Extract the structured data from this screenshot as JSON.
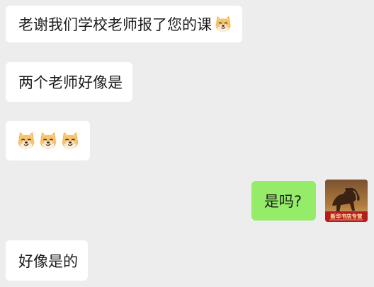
{
  "messages": [
    {
      "side": "left",
      "text": "老谢我们学校老师报了您的课",
      "emoji": "doge-emoji"
    },
    {
      "side": "left",
      "text": "两个老师好像是"
    },
    {
      "side": "left",
      "text": "",
      "emoji": "doge-emoji",
      "emoji_count": 3
    },
    {
      "side": "right",
      "text": "是吗?"
    },
    {
      "side": "left",
      "text": "好像是的"
    }
  ],
  "avatar": {
    "caption": "新华书店专营",
    "icon": "horse-painting-avatar"
  },
  "colors": {
    "background": "#ededed",
    "incoming_bubble": "#ffffff",
    "outgoing_bubble": "#95ec69",
    "doge_fur": "#f4c46c"
  }
}
